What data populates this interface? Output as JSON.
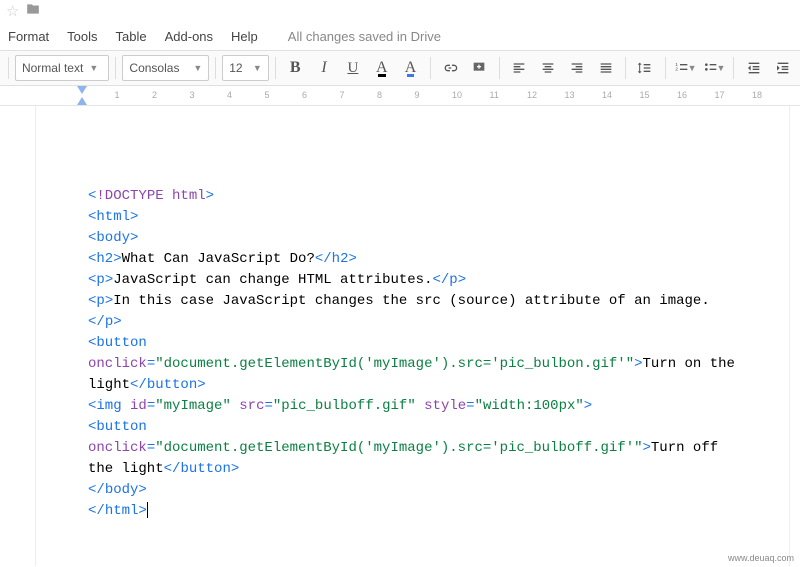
{
  "menu": {
    "format": "Format",
    "tools": "Tools",
    "table": "Table",
    "addons": "Add-ons",
    "help": "Help",
    "save_status": "All changes saved in Drive"
  },
  "toolbar": {
    "style": "Normal text",
    "font": "Consolas",
    "size": "12"
  },
  "ruler": {
    "ticks": [
      "1",
      "2",
      "3",
      "4",
      "5",
      "6",
      "7",
      "8",
      "9",
      "10",
      "11",
      "12",
      "13",
      "14",
      "15",
      "16",
      "17",
      "18"
    ]
  },
  "document": {
    "lines": [
      {
        "type": "doctype",
        "tokens": [
          [
            "<",
            "k-tag"
          ],
          [
            "!DOCTYPE html",
            "k-doctype"
          ],
          [
            ">",
            "k-tag"
          ]
        ]
      },
      {
        "type": "tag",
        "tokens": [
          [
            "<",
            "k-tag"
          ],
          [
            "html",
            "k-tag"
          ],
          [
            ">",
            "k-tag"
          ]
        ]
      },
      {
        "type": "tag",
        "tokens": [
          [
            "<",
            "k-tag"
          ],
          [
            "body",
            "k-tag"
          ],
          [
            ">",
            "k-tag"
          ]
        ]
      },
      {
        "type": "mixed",
        "tokens": [
          [
            "<",
            "k-tag"
          ],
          [
            "h2",
            "k-tag"
          ],
          [
            ">",
            "k-tag"
          ],
          [
            "What Can JavaScript Do?",
            "k-text"
          ],
          [
            "</",
            "k-tag"
          ],
          [
            "h2",
            "k-tag"
          ],
          [
            ">",
            "k-tag"
          ]
        ]
      },
      {
        "type": "mixed",
        "tokens": [
          [
            "<",
            "k-tag"
          ],
          [
            "p",
            "k-tag"
          ],
          [
            ">",
            "k-tag"
          ],
          [
            "JavaScript can change HTML attributes.",
            "k-text"
          ],
          [
            "</",
            "k-tag"
          ],
          [
            "p",
            "k-tag"
          ],
          [
            ">",
            "k-tag"
          ]
        ]
      },
      {
        "type": "mixed",
        "tokens": [
          [
            "<",
            "k-tag"
          ],
          [
            "p",
            "k-tag"
          ],
          [
            ">",
            "k-tag"
          ],
          [
            "In this case JavaScript changes the src (source) attribute of an image.",
            "k-text"
          ],
          [
            "</",
            "k-tag"
          ],
          [
            "p",
            "k-tag"
          ],
          [
            ">",
            "k-tag"
          ]
        ]
      },
      {
        "type": "mixed",
        "tokens": [
          [
            "<",
            "k-tag"
          ],
          [
            "button",
            "k-tag"
          ],
          [
            " ",
            "k-text"
          ],
          [
            "onclick",
            "k-attr"
          ],
          [
            "=",
            "k-eq"
          ],
          [
            "\"document.getElementById('myImage').src='pic_bulbon.gif'\"",
            "k-val"
          ],
          [
            ">",
            "k-tag"
          ],
          [
            "Turn on the light",
            "k-text"
          ],
          [
            "</",
            "k-tag"
          ],
          [
            "button",
            "k-tag"
          ],
          [
            ">",
            "k-tag"
          ]
        ]
      },
      {
        "type": "mixed",
        "tokens": [
          [
            "<",
            "k-tag"
          ],
          [
            "img",
            "k-tag"
          ],
          [
            " ",
            "k-text"
          ],
          [
            "id",
            "k-attr"
          ],
          [
            "=",
            "k-eq"
          ],
          [
            "\"myImage\"",
            "k-val"
          ],
          [
            " ",
            "k-text"
          ],
          [
            "src",
            "k-attr"
          ],
          [
            "=",
            "k-eq"
          ],
          [
            "\"pic_bulboff.gif\"",
            "k-val"
          ],
          [
            " ",
            "k-text"
          ],
          [
            "style",
            "k-attr"
          ],
          [
            "=",
            "k-eq"
          ],
          [
            "\"width:100px\"",
            "k-val"
          ],
          [
            ">",
            "k-tag"
          ]
        ]
      },
      {
        "type": "mixed",
        "tokens": [
          [
            "<",
            "k-tag"
          ],
          [
            "button",
            "k-tag"
          ],
          [
            " ",
            "k-text"
          ],
          [
            "onclick",
            "k-attr"
          ],
          [
            "=",
            "k-eq"
          ],
          [
            "\"document.getElementById('myImage').src='pic_bulboff.gif'\"",
            "k-val"
          ],
          [
            ">",
            "k-tag"
          ],
          [
            "Turn off the light",
            "k-text"
          ],
          [
            "</",
            "k-tag"
          ],
          [
            "button",
            "k-tag"
          ],
          [
            ">",
            "k-tag"
          ]
        ]
      },
      {
        "type": "tag",
        "tokens": [
          [
            "</",
            "k-tag"
          ],
          [
            "body",
            "k-tag"
          ],
          [
            ">",
            "k-tag"
          ]
        ]
      },
      {
        "type": "tag",
        "tokens": [
          [
            "</",
            "k-tag"
          ],
          [
            "html",
            "k-tag"
          ],
          [
            ">",
            "k-tag"
          ]
        ]
      }
    ]
  },
  "watermark": "www.deuaq.com"
}
